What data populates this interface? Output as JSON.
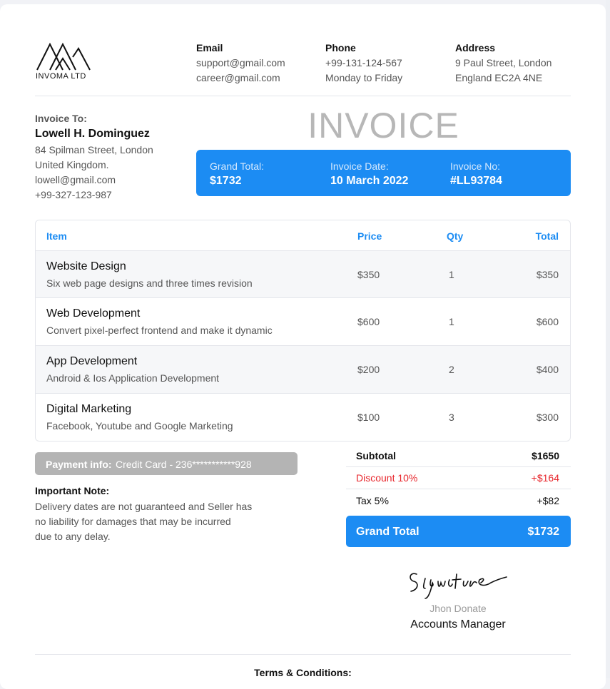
{
  "company": {
    "name": "INVOMA LTD"
  },
  "contact": {
    "email": {
      "label": "Email",
      "lines": [
        "support@gmail.com",
        "career@gmail.com"
      ]
    },
    "phone": {
      "label": "Phone",
      "lines": [
        "+99-131-124-567",
        "Monday to Friday"
      ]
    },
    "address": {
      "label": "Address",
      "lines": [
        "9 Paul Street, London",
        "England EC2A 4NE"
      ]
    }
  },
  "invoice_to": {
    "label": "Invoice To:",
    "name": "Lowell H. Dominguez",
    "lines": [
      "84 Spilman Street, London",
      "United Kingdom.",
      "lowell@gmail.com",
      "+99-327-123-987"
    ]
  },
  "title": "INVOICE",
  "summary_box": {
    "grand_total": {
      "label": "Grand Total:",
      "value": "$1732"
    },
    "invoice_date": {
      "label": "Invoice Date:",
      "value": "10 March 2022"
    },
    "invoice_no": {
      "label": "Invoice No:",
      "value": "#LL93784"
    }
  },
  "table": {
    "headers": {
      "item": "Item",
      "price": "Price",
      "qty": "Qty",
      "total": "Total"
    },
    "rows": [
      {
        "title": "Website Design",
        "desc": "Six web page designs and three times revision",
        "price": "$350",
        "qty": "1",
        "total": "$350"
      },
      {
        "title": "Web Development",
        "desc": "Convert pixel-perfect frontend and make it dynamic",
        "price": "$600",
        "qty": "1",
        "total": "$600"
      },
      {
        "title": "App Development",
        "desc": "Android & Ios Application Development",
        "price": "$200",
        "qty": "2",
        "total": "$400"
      },
      {
        "title": "Digital Marketing",
        "desc": "Facebook, Youtube and Google Marketing",
        "price": "$100",
        "qty": "3",
        "total": "$300"
      }
    ]
  },
  "payment_info": {
    "label": "Payment info:",
    "value": "Credit Card - 236***********928"
  },
  "note": {
    "heading": "Important Note:",
    "lines": [
      "Delivery dates are not guaranteed and Seller has",
      "no liability for damages that may be incurred",
      "due to any delay."
    ]
  },
  "totals": {
    "subtotal": {
      "label": "Subtotal",
      "value": "$1650"
    },
    "discount": {
      "label": "Discount 10%",
      "value": "+$164"
    },
    "tax": {
      "label": "Tax 5%",
      "value": "+$82"
    },
    "grand_total": {
      "label": "Grand Total",
      "value": "$1732"
    }
  },
  "signature": {
    "script": "Signature",
    "name": "Jhon Donate",
    "role": "Accounts Manager"
  },
  "terms": "Terms & Conditions:",
  "colors": {
    "accent": "#1c8cf3",
    "discount": "#e8262c",
    "muted": "#b7b7b7"
  }
}
